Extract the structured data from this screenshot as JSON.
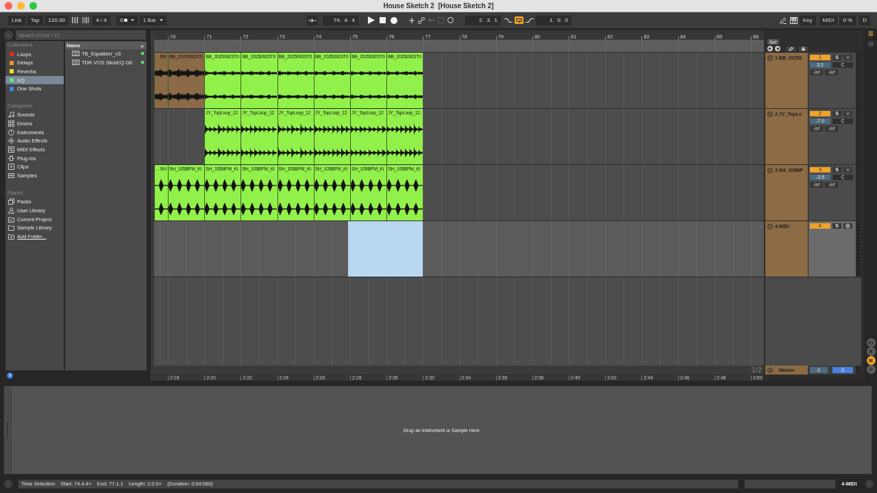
{
  "window": {
    "title": "House Sketch 2  [House Sketch 2]"
  },
  "control_bar": {
    "link": "Link",
    "tap": "Tap",
    "tempo": "120.00",
    "time_signature": "4 / 4",
    "quantization": "1 Bar",
    "arrangement_position": "74.  4.  4",
    "loop_start": "2.  3.  1",
    "loop": {
      "on": true
    },
    "loop_length": "1.  0.  0",
    "key_map": "Key",
    "midi_map": "MIDI",
    "cpu_load": "0 %",
    "disk": "D"
  },
  "browser": {
    "search": {
      "placeholder": "Search (Cmd + F)"
    },
    "sections": [
      {
        "title": "Collections",
        "items": [
          {
            "label": "Loops",
            "color": "#e8281f",
            "selected": false
          },
          {
            "label": "Delays",
            "color": "#f0902a",
            "selected": false
          },
          {
            "label": "Reverbs",
            "color": "#f2e12a",
            "selected": false
          },
          {
            "label": "EQ",
            "color": "#63e28a",
            "selected": true
          },
          {
            "label": "One Shots",
            "color": "#3d8ee8",
            "selected": false
          }
        ]
      },
      {
        "title": "Categories",
        "items": [
          {
            "label": "Sounds",
            "selected": false
          },
          {
            "label": "Drums",
            "selected": false
          },
          {
            "label": "Instruments",
            "selected": false
          },
          {
            "label": "Audio Effects",
            "selected": false
          },
          {
            "label": "MIDI Effects",
            "selected": false
          },
          {
            "label": "Plug-Ins",
            "selected": false
          },
          {
            "label": "Clips",
            "selected": false
          },
          {
            "label": "Samples",
            "selected": false
          }
        ]
      },
      {
        "title": "Places",
        "items": [
          {
            "kind": "place",
            "label": "Packs",
            "selected": false
          },
          {
            "kind": "place",
            "label": "User Library",
            "selected": false
          },
          {
            "kind": "place",
            "label": "Current Project",
            "selected": false
          },
          {
            "kind": "place",
            "label": "Sample Library",
            "selected": false
          },
          {
            "kind": "link",
            "label": "Add Folder...",
            "selected": false
          }
        ]
      }
    ],
    "results": {
      "column": "Name",
      "items": [
        {
          "name": "TB_Equalizer_v3"
        },
        {
          "name": "TDR VOS SlickEQ GE"
        }
      ]
    }
  },
  "arrangement": {
    "ruler": [
      "70",
      "71",
      "72",
      "73",
      "74",
      "75",
      "76",
      "77",
      "78",
      "79",
      "80",
      "81",
      "82",
      "83",
      "84",
      "85",
      "86"
    ],
    "set_label": "Set",
    "tracks": [
      {
        "name": "1 BB_20250",
        "kind": "audio",
        "number": "1",
        "active": true,
        "solo_label": "S",
        "solo": false,
        "armed": false,
        "selected": false,
        "volume": "3.2",
        "pan": "C",
        "peaks": [
          "-inf",
          "-inf"
        ],
        "clips": [
          {
            "kind": "clip",
            "label": "... BB",
            "color": "#8a6a47"
          },
          {
            "kind": "clip",
            "label": "BB_20250923T0",
            "color": "#8a6a47"
          },
          {
            "kind": "clip",
            "label": "BB_20250923T0",
            "color": "#92f04b"
          },
          {
            "kind": "clip",
            "label": "BB_20250923T0",
            "color": "#92f04b"
          },
          {
            "kind": "clip",
            "label": "BB_20250923T0",
            "color": "#92f04b"
          },
          {
            "kind": "clip",
            "label": "BB_20250923T0",
            "color": "#92f04b"
          },
          {
            "kind": "clip",
            "label": "BB_20250923T0",
            "color": "#92f04b"
          },
          {
            "kind": "clip",
            "label": "BB_20250923T0",
            "color": "#92f04b"
          }
        ]
      },
      {
        "name": "2 JY_TopLo",
        "kind": "audio",
        "number": "2",
        "active": true,
        "solo_label": "S",
        "solo": false,
        "armed": false,
        "selected": false,
        "volume": "-7.0",
        "pan": "C",
        "peaks": [
          "-inf",
          "-inf"
        ],
        "clips": [
          {
            "kind": "gap"
          },
          {
            "kind": "gap"
          },
          {
            "kind": "clip",
            "label": "JY_TopLoop_12",
            "color": "#92f04b"
          },
          {
            "kind": "clip",
            "label": "JY_TopLoop_12",
            "color": "#92f04b"
          },
          {
            "kind": "clip",
            "label": "JY_TopLoop_12",
            "color": "#92f04b"
          },
          {
            "kind": "clip",
            "label": "JY_TopLoop_12",
            "color": "#92f04b"
          },
          {
            "kind": "clip",
            "label": "JY_TopLoop_12",
            "color": "#92f04b"
          },
          {
            "kind": "clip",
            "label": "JY_TopLoop_12",
            "color": "#92f04b"
          }
        ]
      },
      {
        "name": "3 SH_105BP",
        "kind": "audio",
        "number": "3",
        "active": true,
        "solo_label": "S",
        "solo": false,
        "armed": false,
        "selected": false,
        "volume": "-3.5",
        "pan": "C",
        "peaks": [
          "-inf",
          "-inf"
        ],
        "clips": [
          {
            "kind": "clip",
            "label": "... SH",
            "color": "#92f04b"
          },
          {
            "kind": "clip",
            "label": "SH_105BPM_Ki",
            "color": "#92f04b"
          },
          {
            "kind": "clip",
            "label": "SH_105BPM_Ki",
            "color": "#92f04b"
          },
          {
            "kind": "clip",
            "label": "SH_105BPM_Ki",
            "color": "#92f04b"
          },
          {
            "kind": "clip",
            "label": "SH_105BPM_Ki",
            "color": "#92f04b"
          },
          {
            "kind": "clip",
            "label": "SH_105BPM_Ki",
            "color": "#92f04b"
          },
          {
            "kind": "clip",
            "label": "SH_105BPM_Ki",
            "color": "#92f04b"
          },
          {
            "kind": "clip",
            "label": "SH_105BPM_Ki",
            "color": "#92f04b"
          }
        ]
      },
      {
        "name": "4 MIDI",
        "kind": "midi",
        "number": "4",
        "active": true,
        "solo_label": "S",
        "solo": false,
        "armed": false,
        "selected": true
      }
    ],
    "grid": "1/2",
    "master": {
      "name": "Master",
      "fields": [
        "0",
        "0"
      ]
    },
    "time_ruler": [
      "2:18",
      "2:20",
      "2:22",
      "2:24",
      "2:26",
      "2:28",
      "2:30",
      "2:32",
      "2:34",
      "2:36",
      "2:38",
      "2:40",
      "2:42",
      "2:44",
      "2:46",
      "2:48",
      "2:50"
    ]
  },
  "view_toggles": [
    {
      "label": "IO",
      "on": false
    },
    {
      "label": "R",
      "on": false
    },
    {
      "label": "M",
      "on": true
    },
    {
      "label": "D",
      "on": false
    }
  ],
  "detail_view": {
    "hint": "Drop an Instrument or Sample Here"
  },
  "status_bar": {
    "items": [
      "Time Selection",
      "Start: 74.4.4+",
      "End: 77.1.1",
      "Length: 2.0.0+",
      "(Duration: 0:04:060)"
    ],
    "track": "4-MIDI"
  }
}
